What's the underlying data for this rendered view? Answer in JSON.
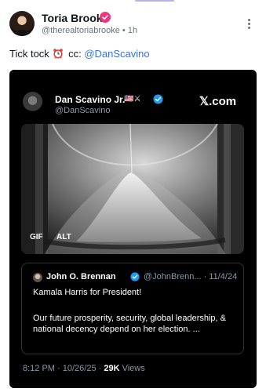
{
  "post": {
    "author_name": "Toria Brooke",
    "handle": "@therealtoriabrooke",
    "separator": "•",
    "time": "1h",
    "text_before": "Tick tock",
    "text_middle": "cc:",
    "mention": "@DanScavino",
    "icons": [
      "verified-badge-icon",
      "alarm-clock-icon",
      "more-options-icon"
    ],
    "colors": {
      "badge": "#f0357d",
      "mention": "#3a6ee6"
    }
  },
  "embed": {
    "author_name": "Dan Scavino Jr.",
    "flags": "🇺🇸⚔",
    "handle": "@DanScavino",
    "site_label": "𝕏.com",
    "media": {
      "gif_label": "GIF",
      "alt_label": "ALT"
    },
    "quote": {
      "author_name": "John O. Brennan",
      "meta": "@JohnBrenn... · 11/4/24",
      "line1": "Kamala Harris for President!",
      "body": "Our future prosperity, security, global leadership, & national decency depend on her election. ..."
    },
    "footer": {
      "timestamp": "8:12 PM · 10/26/25 · ",
      "views_count": "29K",
      "views_label": " Views"
    }
  }
}
